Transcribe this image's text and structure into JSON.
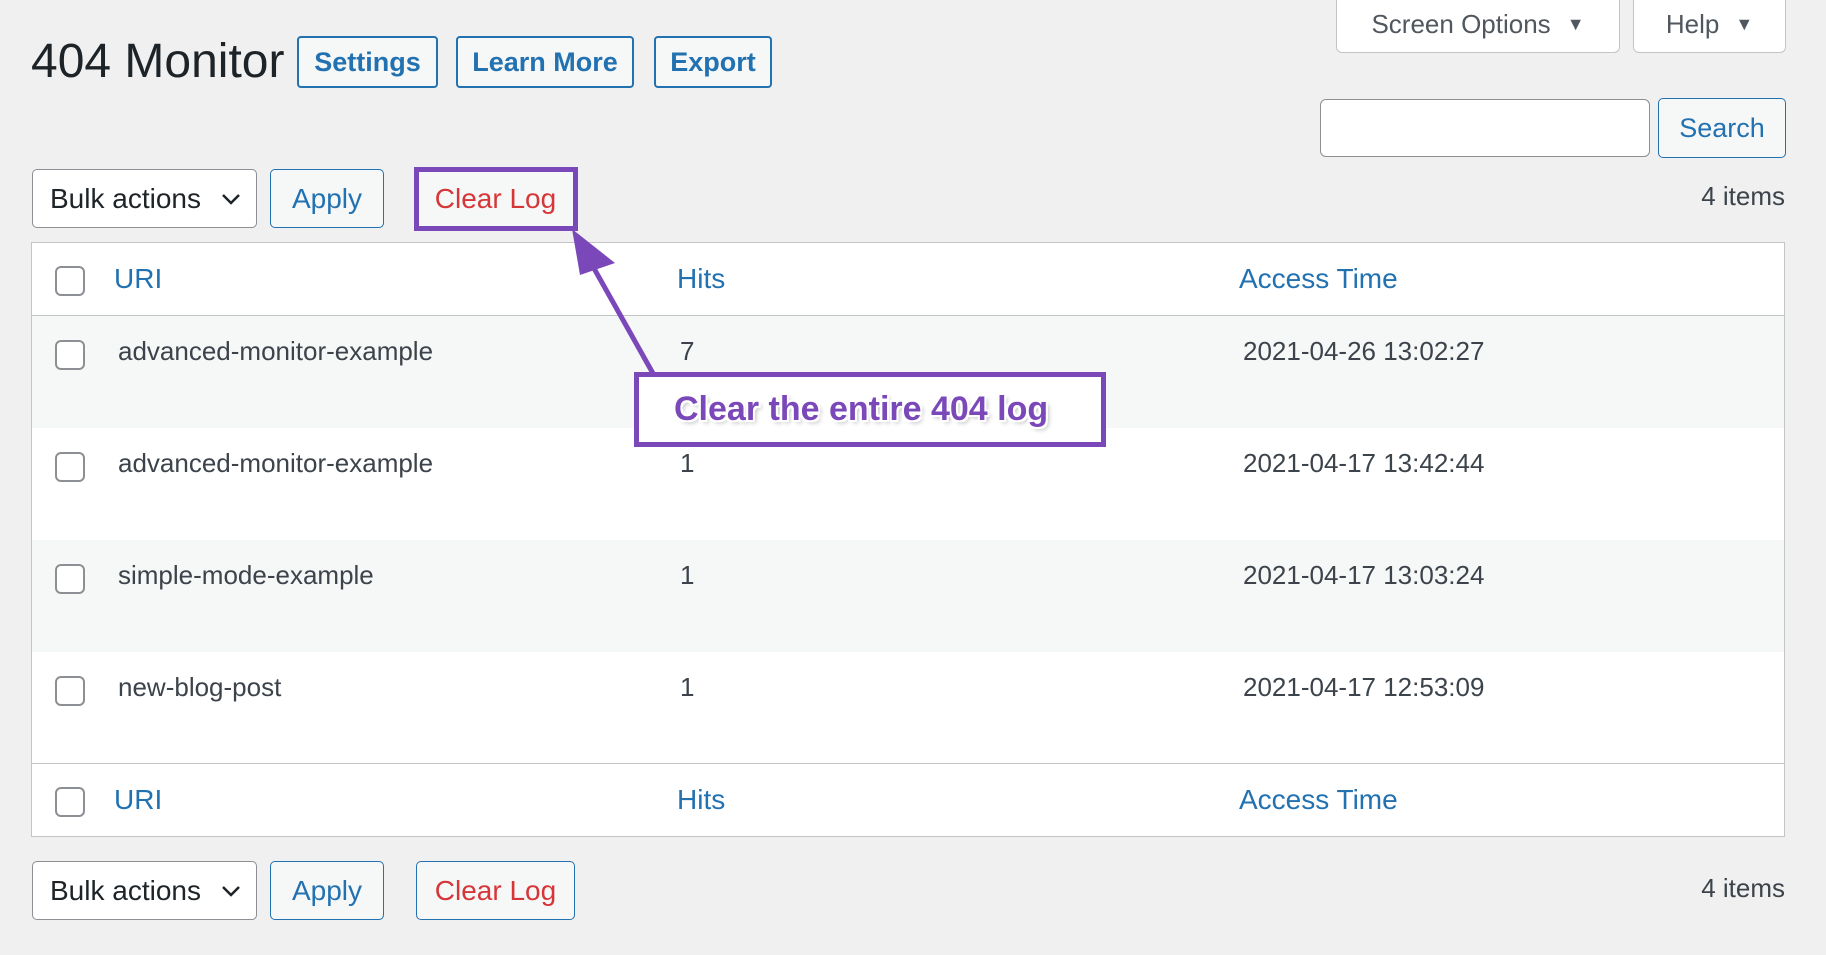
{
  "page": {
    "title": "404 Monitor",
    "title_buttons": [
      "Settings",
      "Learn More",
      "Export"
    ]
  },
  "screen_meta": {
    "screen_options": "Screen Options",
    "help": "Help"
  },
  "search": {
    "value": "",
    "placeholder": "",
    "button": "Search"
  },
  "tablenav_top": {
    "bulk_actions": "Bulk actions",
    "apply": "Apply",
    "clear_log": "Clear Log",
    "count": "4 items"
  },
  "table": {
    "headers": [
      "URI",
      "Hits",
      "Access Time"
    ],
    "rows": [
      {
        "uri": "advanced-monitor-example",
        "hits": "7",
        "access_time": "2021-04-26 13:02:27"
      },
      {
        "uri": "advanced-monitor-example",
        "hits": "1",
        "access_time": "2021-04-17 13:42:44"
      },
      {
        "uri": "simple-mode-example",
        "hits": "1",
        "access_time": "2021-04-17 13:03:24"
      },
      {
        "uri": "new-blog-post",
        "hits": "1",
        "access_time": "2021-04-17 12:53:09"
      }
    ]
  },
  "tablenav_bottom": {
    "bulk_actions": "Bulk actions",
    "apply": "Apply",
    "clear_log": "Clear Log",
    "count": "4 items"
  },
  "annotation": {
    "callout": "Clear the entire 404 log",
    "color": "#7b48b9"
  },
  "colors": {
    "link": "#2271b1",
    "danger": "#d63638",
    "background": "#f0f0f1"
  }
}
